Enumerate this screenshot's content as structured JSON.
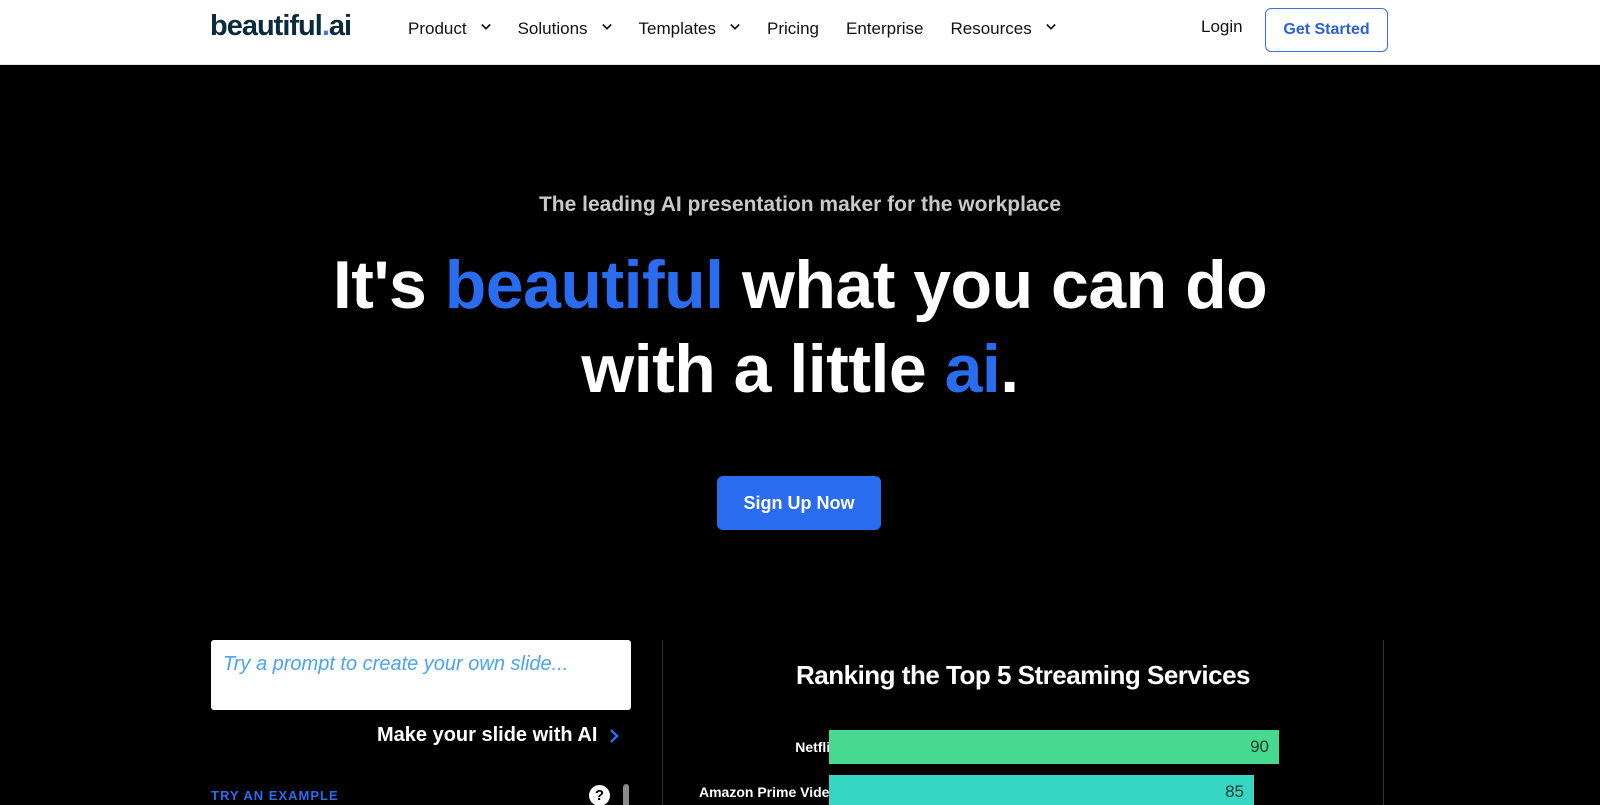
{
  "nav": {
    "logo_main": "beautiful",
    "logo_dot": ".",
    "logo_suffix": "ai",
    "items": [
      {
        "label": "Product",
        "dropdown": true
      },
      {
        "label": "Solutions",
        "dropdown": true
      },
      {
        "label": "Templates",
        "dropdown": true
      },
      {
        "label": "Pricing",
        "dropdown": false
      },
      {
        "label": "Enterprise",
        "dropdown": false
      },
      {
        "label": "Resources",
        "dropdown": true
      }
    ],
    "login": "Login",
    "get_started": "Get Started"
  },
  "hero": {
    "tagline": "The leading AI presentation maker for the workplace",
    "headline_part1": "It's ",
    "headline_blue1": "beautiful",
    "headline_part2": " what you can do",
    "headline_part3": "with a little ",
    "headline_blue2": "ai",
    "headline_end": ".",
    "signup": "Sign Up Now"
  },
  "prompt": {
    "placeholder": "Try a prompt to create your own slide...",
    "make_label": "Make your slide with AI",
    "try_example": "TRY AN EXAMPLE",
    "help": "?"
  },
  "colors": {
    "accent": "#2a6cf0",
    "bar_green": "#46d98f",
    "bar_teal": "#36d6c2"
  },
  "chart_data": {
    "type": "bar",
    "orientation": "horizontal",
    "title": "Ranking the Top 5 Streaming Services",
    "categories": [
      "Netflix",
      "Amazon Prime Video"
    ],
    "values": [
      90,
      85
    ],
    "xlim": [
      0,
      100
    ]
  }
}
